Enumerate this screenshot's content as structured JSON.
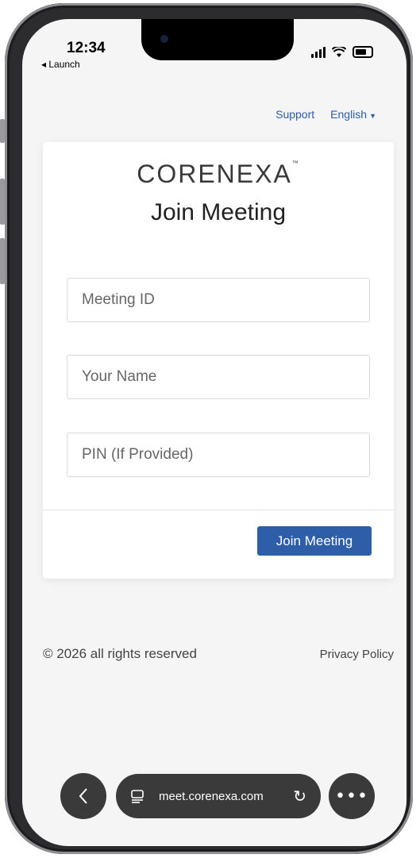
{
  "status": {
    "time": "12:34",
    "back": "◂ Launch"
  },
  "header": {
    "support": "Support",
    "language": "English"
  },
  "card": {
    "logo": "CORENEXA",
    "logo_mark": "™",
    "title": "Join Meeting",
    "fields": {
      "meeting_id_placeholder": "Meeting ID",
      "name_placeholder": "Your Name",
      "pin_placeholder": "PIN (If Provided)"
    },
    "join_label": "Join Meeting"
  },
  "footer": {
    "copyright": "© 2026 all rights reserved",
    "privacy": "Privacy Policy"
  },
  "browser": {
    "url": "meet.corenexa.com"
  },
  "colors": {
    "accent": "#2e5ea8",
    "link": "#2b5ca8",
    "background": "#f5f5f5"
  }
}
